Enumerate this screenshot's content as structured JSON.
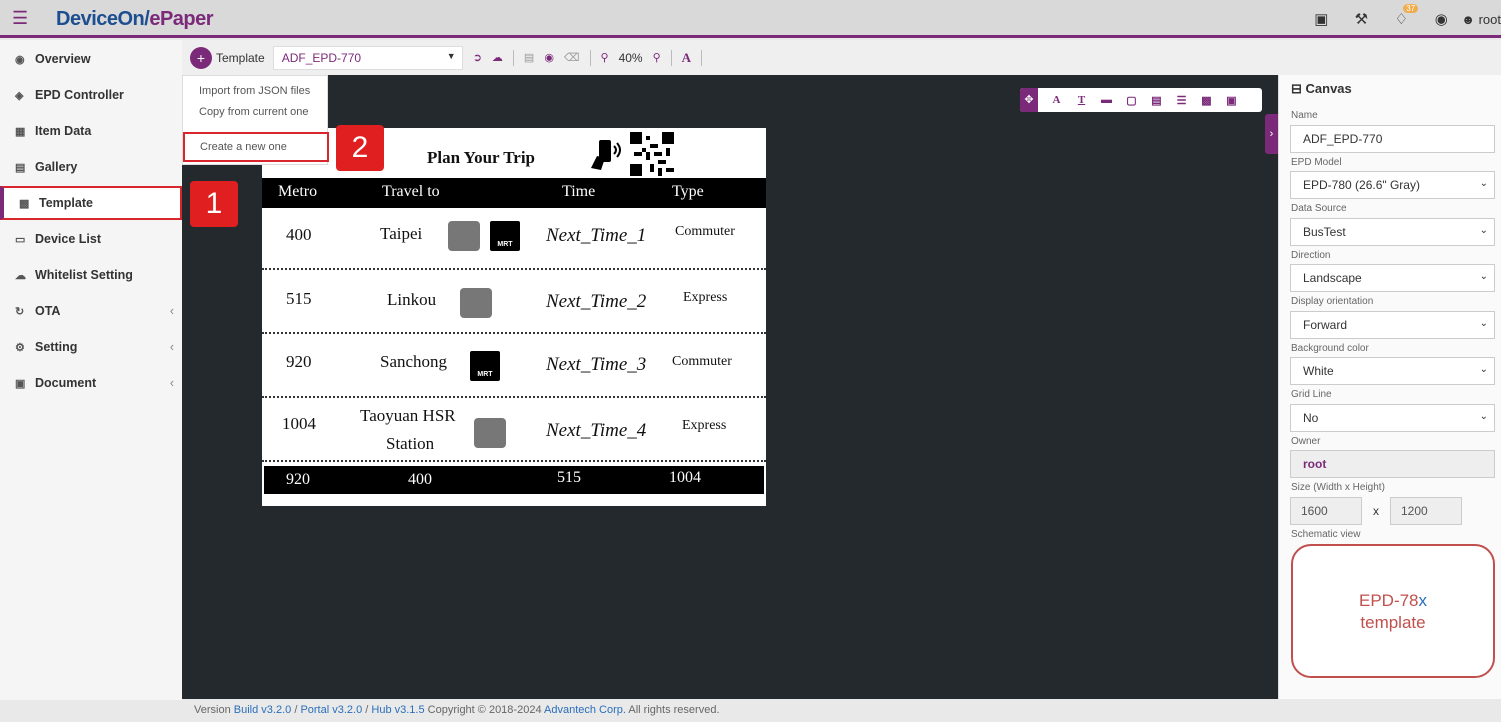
{
  "app": {
    "logo_main": "DeviceOn/",
    "logo_accent": "ePaper",
    "notification_count": "37",
    "user": "root"
  },
  "sidebar": {
    "items": [
      {
        "label": "Overview",
        "icon": "dashboard-icon"
      },
      {
        "label": "EPD Controller",
        "icon": "tag-icon"
      },
      {
        "label": "Item Data",
        "icon": "table-icon"
      },
      {
        "label": "Gallery",
        "icon": "image-icon"
      },
      {
        "label": "Template",
        "icon": "card-icon"
      },
      {
        "label": "Device List",
        "icon": "monitor-icon"
      },
      {
        "label": "Whitelist Setting",
        "icon": "cloud-icon"
      },
      {
        "label": "OTA",
        "icon": "refresh-icon"
      },
      {
        "label": "Setting",
        "icon": "cogs-icon"
      },
      {
        "label": "Document",
        "icon": "book-icon"
      }
    ]
  },
  "toolbar": {
    "template_label": "Template",
    "template_select": "ADF_EPD-770",
    "zoom": "40%"
  },
  "dropdown": {
    "import_json": "Import from JSON files",
    "copy_current": "Copy from current one",
    "create_new": "Create a new one"
  },
  "markers": {
    "one": "1",
    "two": "2"
  },
  "preview": {
    "title": "Plan Your Trip",
    "headers": {
      "metro": "Metro",
      "travel": "Travel to",
      "time": "Time",
      "type": "Type"
    },
    "rows": [
      {
        "metro": "400",
        "dest": "Taipei",
        "dest2": "",
        "time": "Next_Time_1",
        "type": "Commuter"
      },
      {
        "metro": "515",
        "dest": "Linkou",
        "dest2": "",
        "time": "Next_Time_2",
        "type": "Express"
      },
      {
        "metro": "920",
        "dest": "Sanchong",
        "dest2": "",
        "time": "Next_Time_3",
        "type": "Commuter"
      },
      {
        "metro": "1004",
        "dest": "Taoyuan HSR",
        "dest2": "Station",
        "time": "Next_Time_4",
        "type": "Express"
      }
    ],
    "mrt_label": "MRT",
    "footer": [
      "920",
      "400",
      "515",
      "1004"
    ]
  },
  "panel": {
    "title": "Canvas",
    "name_label": "Name",
    "name_value": "ADF_EPD-770",
    "model_label": "EPD Model",
    "model_value": "EPD-780 (26.6\" Gray)",
    "source_label": "Data Source",
    "source_value": "BusTest",
    "direction_label": "Direction",
    "direction_value": "Landscape",
    "orientation_label": "Display orientation",
    "orientation_value": "Forward",
    "bg_label": "Background color",
    "bg_value": "White",
    "grid_label": "Grid Line",
    "grid_value": "No",
    "owner_label": "Owner",
    "owner_value": "root",
    "size_label": "Size (Width x Height)",
    "width": "1600",
    "size_x": "x",
    "height": "1200",
    "schematic_label": "Schematic view",
    "schematic_main": "EPD-78",
    "schematic_x": "x",
    "schematic_sub": "template"
  },
  "footer": {
    "version": "Version",
    "build": "Build v3.2.0",
    "sep1": "/",
    "portal": "Portal v3.2.0",
    "sep2": "/",
    "hub": "Hub v3.1.5",
    "copyright": "Copyright © 2018-2024",
    "corp": "Advantech Corp.",
    "rights": "All rights reserved."
  },
  "colors": {
    "brand": "#7b2a7a",
    "logo": "#1d4e8f",
    "highlight": "#d9262c"
  }
}
